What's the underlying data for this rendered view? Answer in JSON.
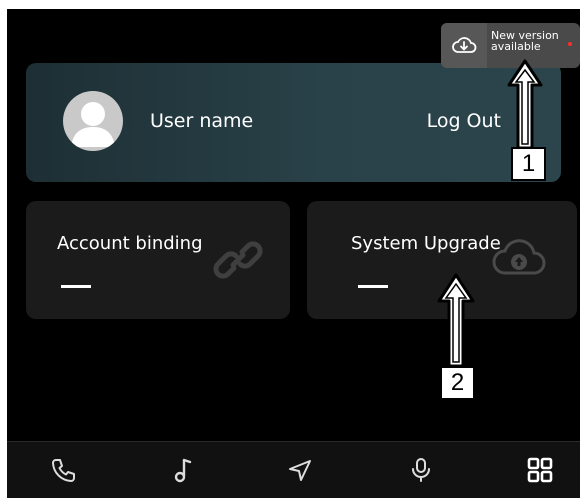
{
  "user": {
    "name": "User name",
    "logout_label": "Log Out"
  },
  "tiles": [
    {
      "title": "Account binding",
      "status": "—",
      "icon": "link-icon"
    },
    {
      "title": "System Upgrade",
      "status": "—",
      "icon": "cloud-upload-icon"
    }
  ],
  "popup": {
    "line1": "New version",
    "line2": "available",
    "icon": "cloud-download-icon",
    "has_notification_dot": true
  },
  "bottom_nav": [
    {
      "name": "phone",
      "icon": "phone-icon"
    },
    {
      "name": "music",
      "icon": "music-note-icon"
    },
    {
      "name": "navigation",
      "icon": "navigation-arrow-icon"
    },
    {
      "name": "voice",
      "icon": "microphone-icon"
    },
    {
      "name": "apps",
      "icon": "app-grid-icon"
    }
  ],
  "annotations": {
    "callout_1": "1",
    "callout_2": "2"
  },
  "colors": {
    "background": "#000000",
    "card_teal": "#294148",
    "tile": "#1b1b1b",
    "popup": "#4a4a4a",
    "notification_dot": "#ff2c2c"
  }
}
